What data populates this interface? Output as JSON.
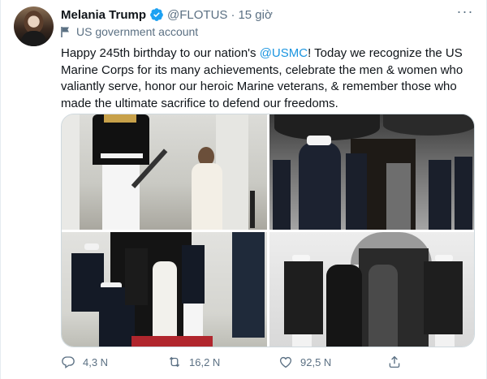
{
  "tweet": {
    "author_name": "Melania Trump",
    "handle": "@FLOTUS",
    "separator": "·",
    "time": "15 giờ",
    "account_label": "US government account",
    "text_parts": {
      "before": "Happy 245th birthday to our nation's ",
      "mention": "@USMC",
      "after": "! Today we recognize the US Marine Corps for its many achievements, celebrate the men & women who valiantly serve, honor our heroic Marine veterans, & remember those who made the ultimate sacrifice to defend our freedoms."
    }
  },
  "actions": {
    "replies": "4,3 N",
    "retweets": "16,2 N",
    "likes": "92,5 N"
  },
  "icons": [
    "verified-badge-icon",
    "more-icon",
    "government-flag-icon",
    "reply-icon",
    "retweet-icon",
    "like-icon",
    "share-icon"
  ],
  "colors": {
    "accent": "#1b95e0",
    "secondary_text": "#5b7083",
    "primary_text": "#0f1419"
  }
}
